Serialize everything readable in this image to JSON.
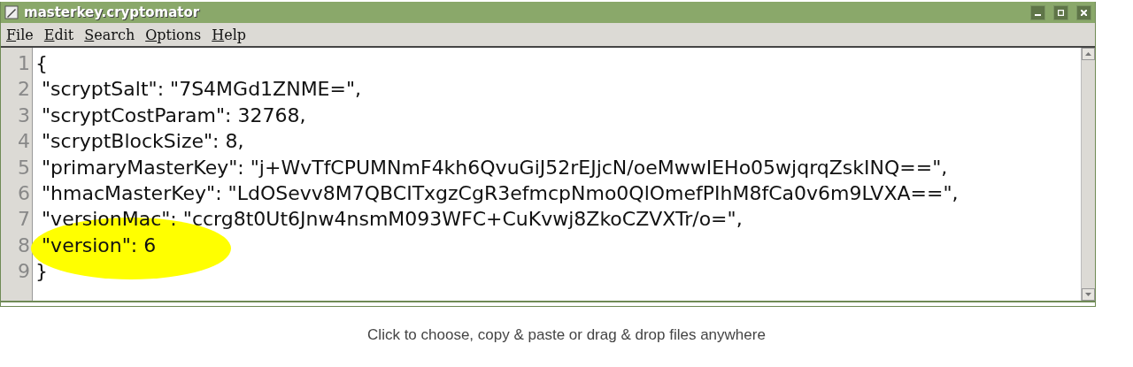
{
  "window": {
    "title": "masterkey.cryptomator"
  },
  "menu": [
    "File",
    "Edit",
    "Search",
    "Options",
    "Help"
  ],
  "editor": {
    "lines": [
      {
        "number": "1",
        "text": "{",
        "highlighted": false
      },
      {
        "number": "2",
        "text": " \"scryptSalt\": \"7S4MGd1ZNME=\",",
        "highlighted": false
      },
      {
        "number": "3",
        "text": " \"scryptCostParam\": 32768,",
        "highlighted": false
      },
      {
        "number": "4",
        "text": " \"scryptBlockSize\": 8,",
        "highlighted": false
      },
      {
        "number": "5",
        "text": " \"primaryMasterKey\": \"j+WvTfCPUMNmF4kh6QvuGiJ52rEJjcN/oeMwwIEHo05wjqrqZskINQ==\",",
        "highlighted": false
      },
      {
        "number": "6",
        "text": " \"hmacMasterKey\": \"LdOSevv8M7QBCITxgzCgR3efmcpNmo0QlOmefPIhM8fCa0v6m9LVXA==\",",
        "highlighted": false
      },
      {
        "number": "7",
        "text": " \"versionMac\": \"ccrg8t0Ut6Jnw4nsmM093WFC+CuKvwj8ZkoCZVXTr/o=\",",
        "highlighted": false
      },
      {
        "number": "8",
        "text": " \"version\": 6",
        "highlighted": true
      },
      {
        "number": "9",
        "text": "}",
        "highlighted": false
      }
    ]
  },
  "hint": "Click to choose, copy & paste or drag & drop files anywhere"
}
